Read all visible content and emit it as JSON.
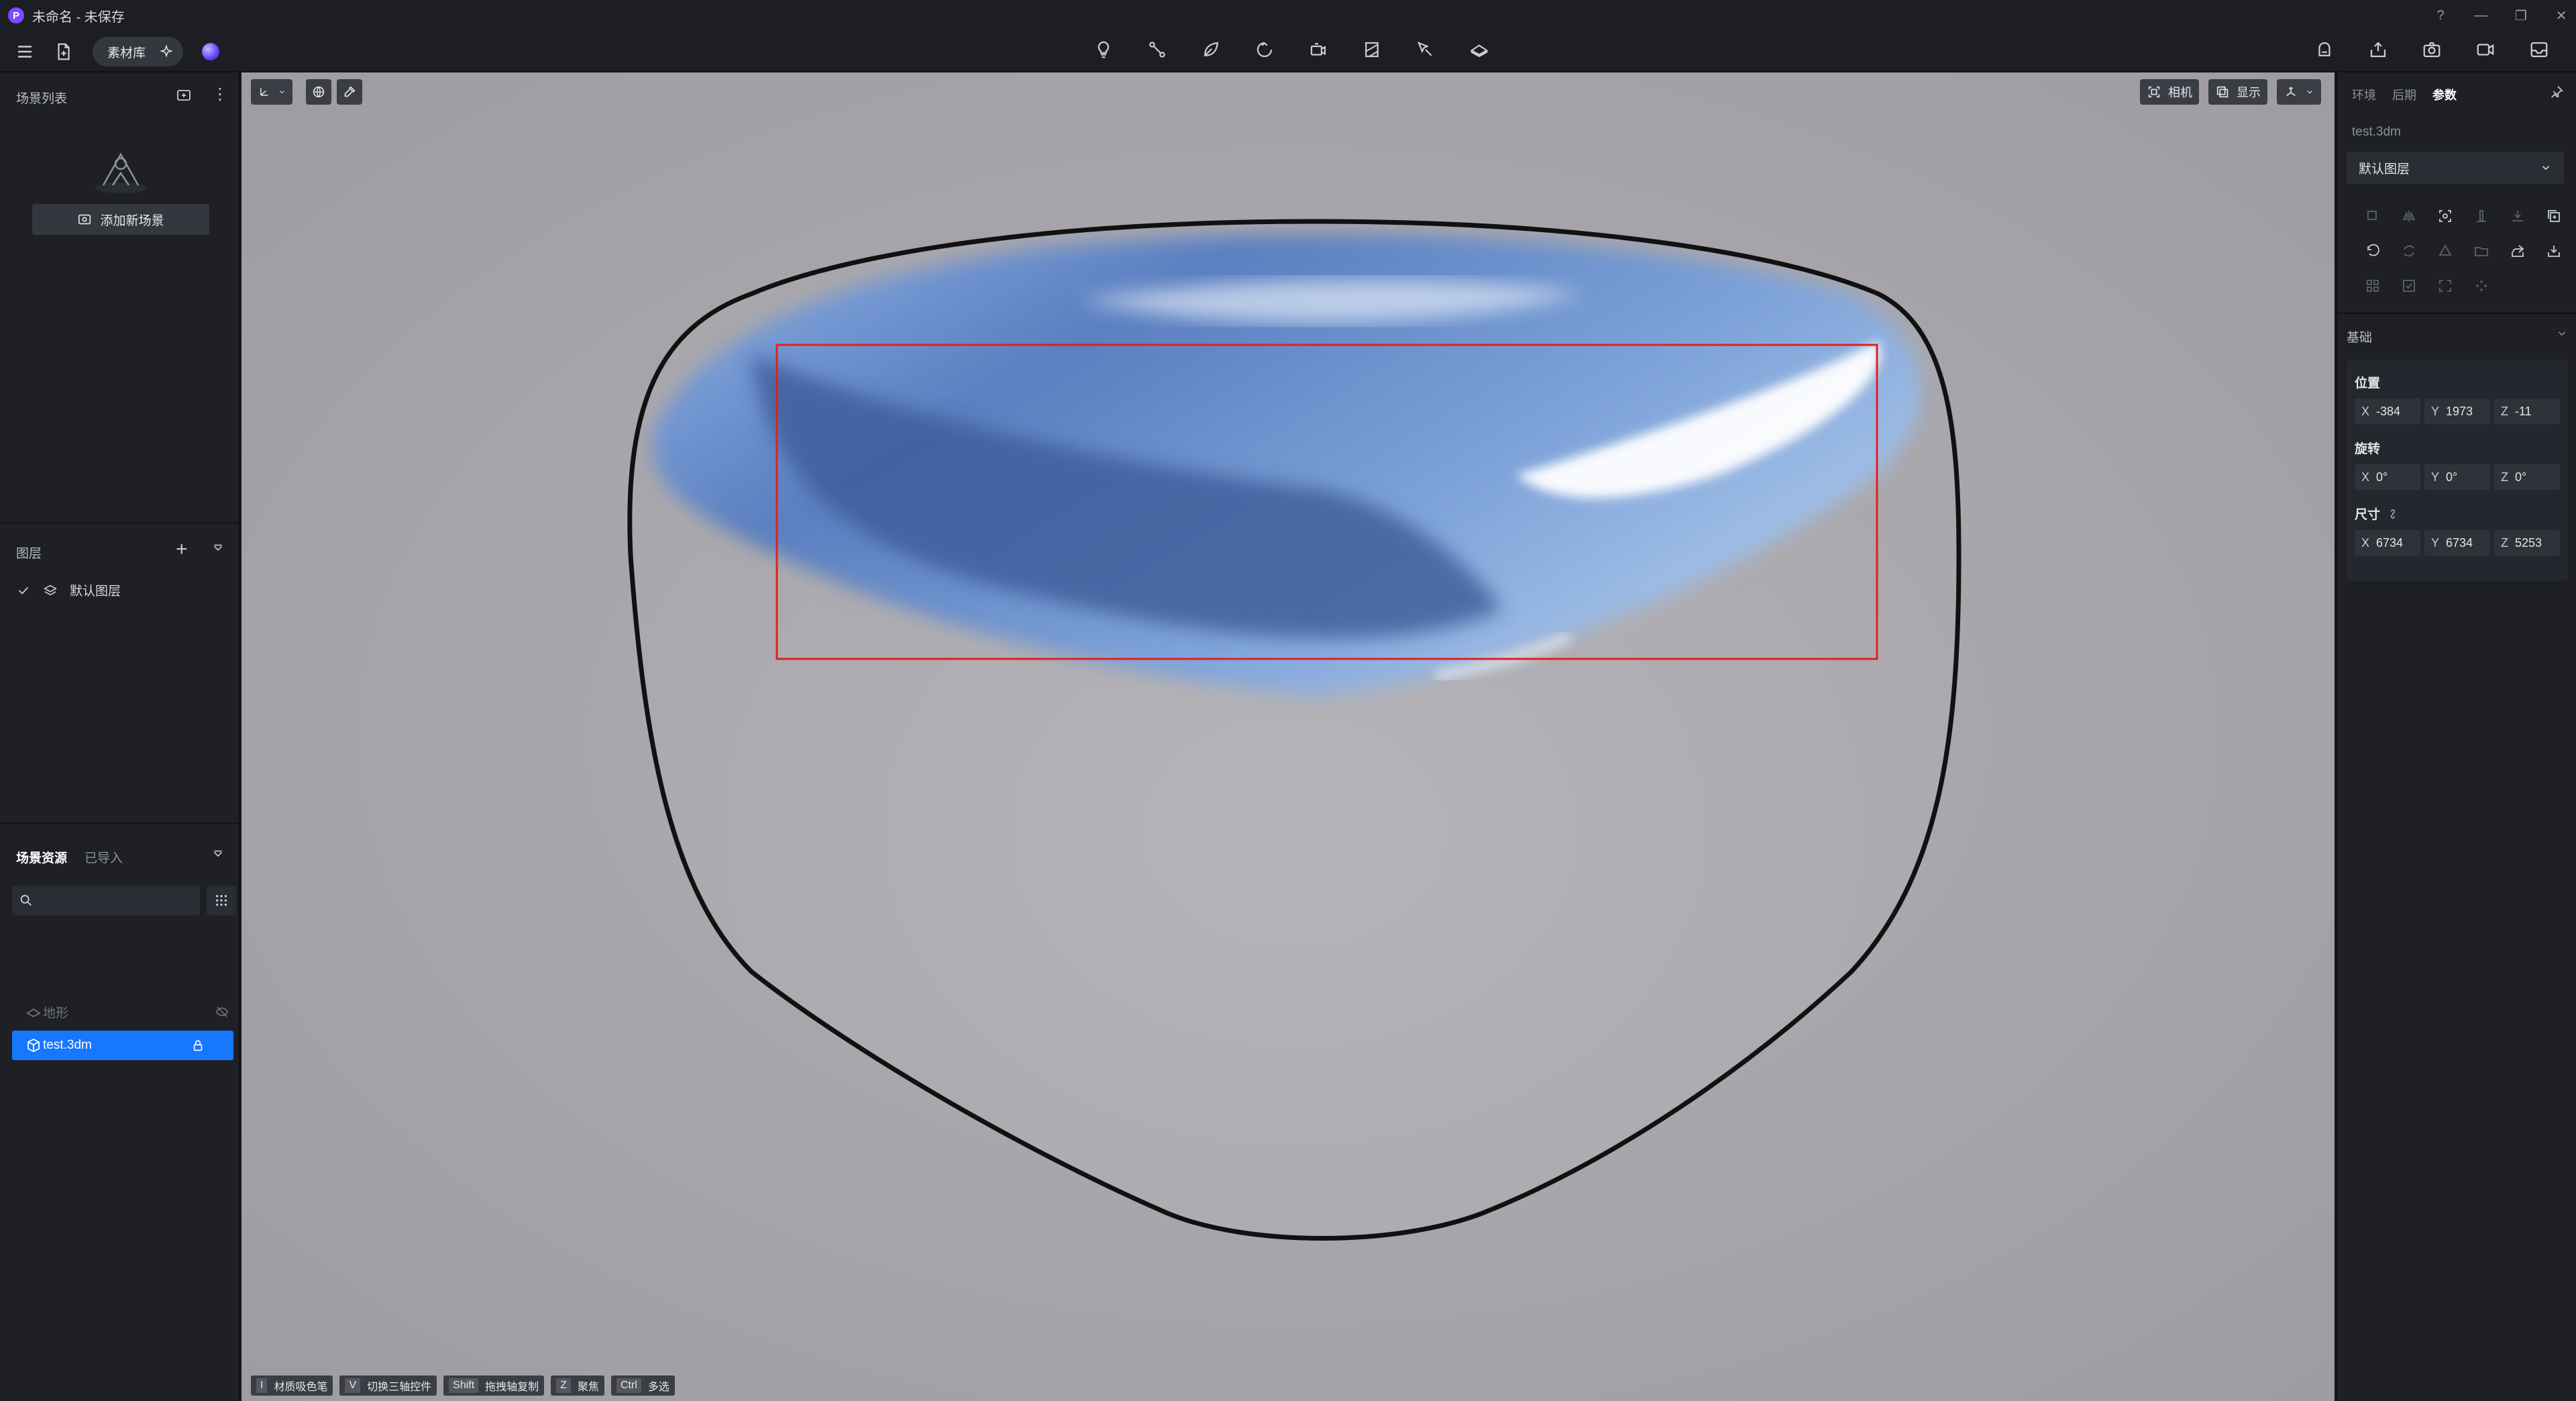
{
  "window": {
    "title": "未命名 - 未保存",
    "logo_letter": "P"
  },
  "toolbar": {
    "library_label": "素材库"
  },
  "left": {
    "scene_list_title": "场景列表",
    "add_scene_label": "添加新场景",
    "layers_title": "图层",
    "layers": [
      {
        "name": "默认图层",
        "visible": true
      }
    ],
    "assets_tabs": [
      "场景资源",
      "已导入"
    ],
    "search": {
      "value": "",
      "placeholder": ""
    },
    "assets": [
      {
        "name": "地形",
        "dimmed": true
      },
      {
        "name": "test.3dm",
        "selected": true
      }
    ]
  },
  "viewport": {
    "camera_label": "相机",
    "display_label": "显示",
    "shortcuts": [
      {
        "key": "I",
        "label": "材质吸色笔"
      },
      {
        "key": "V",
        "label": "切换三轴控件"
      },
      {
        "key": "Shift",
        "label": "拖拽轴复制"
      },
      {
        "key": "Z",
        "label": "聚焦"
      },
      {
        "key": "Ctrl",
        "label": "多选"
      }
    ]
  },
  "right": {
    "tabs": [
      "环境",
      "后期",
      "参数"
    ],
    "active_tab": "参数",
    "object_name": "test.3dm",
    "layer_select": "默认图层",
    "basic_title": "基础",
    "position_label": "位置",
    "position": {
      "x": "X",
      "x_val": "-384",
      "y": "Y",
      "y_val": "1973",
      "z": "Z",
      "z_val": "-11"
    },
    "rotation_label": "旋转",
    "rotation": {
      "x": "X",
      "x_val": "0°",
      "y": "Y",
      "y_val": "0°",
      "z": "Z",
      "z_val": "0°"
    },
    "size_label": "尺寸",
    "size": {
      "x": "X",
      "x_val": "6734",
      "y": "Y",
      "y_val": "6734",
      "z": "Z",
      "z_val": "5253"
    }
  },
  "colors": {
    "accent": "#1677ff",
    "selection_box": "#e02020",
    "background": "#16181d"
  }
}
